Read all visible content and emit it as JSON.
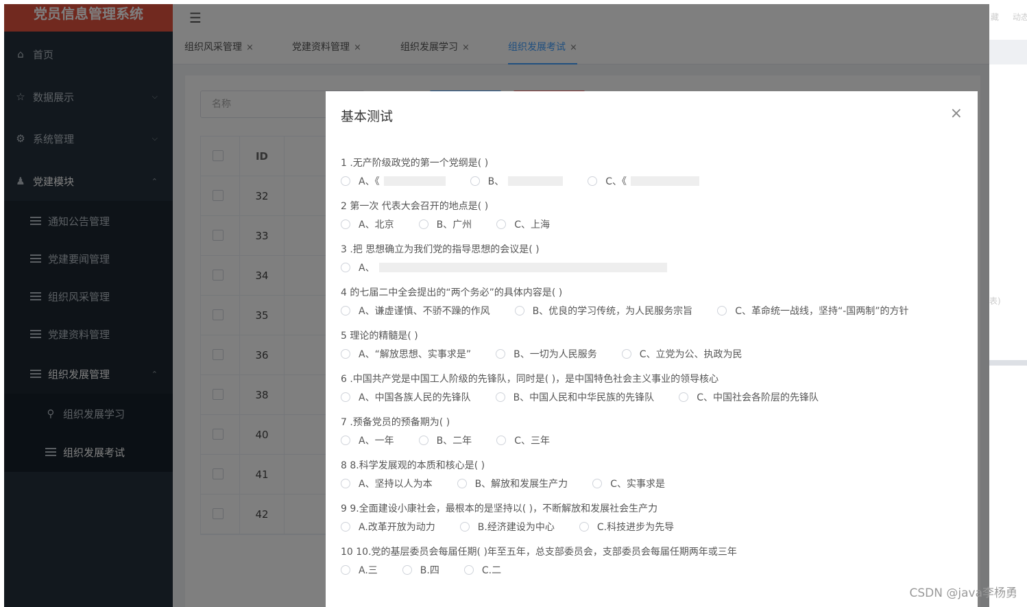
{
  "app": {
    "title": "党员信息管理系统"
  },
  "sidebar": {
    "items": [
      {
        "label": "首页",
        "icon": "home-icon"
      },
      {
        "label": "数据展示",
        "icon": "star-icon"
      },
      {
        "label": "系统管理",
        "icon": "gear-icon"
      },
      {
        "label": "党建模块",
        "icon": "user-icon"
      },
      {
        "label": "通知公告管理",
        "icon": "list-icon"
      },
      {
        "label": "党建要闻管理",
        "icon": "list-icon"
      },
      {
        "label": "组织风采管理",
        "icon": "list-icon"
      },
      {
        "label": "党建资料管理",
        "icon": "list-icon"
      },
      {
        "label": "组织发展管理",
        "icon": "list-icon"
      },
      {
        "label": "组织发展学习",
        "icon": "pin-icon"
      },
      {
        "label": "组织发展考试",
        "icon": "list-icon"
      }
    ]
  },
  "tabs": [
    {
      "label": "组织风采管理",
      "close": "×"
    },
    {
      "label": "党建资料管理",
      "close": "×"
    },
    {
      "label": "组织发展学习",
      "close": "×"
    },
    {
      "label": "组织发展考试",
      "close": "×"
    }
  ],
  "content": {
    "search_placeholder": "名称",
    "table": {
      "id_header": "ID",
      "ids": [
        "32",
        "33",
        "34",
        "35",
        "36",
        "38",
        "40",
        "41",
        "42"
      ]
    }
  },
  "modal": {
    "title": "基本测试",
    "close": "×",
    "questions": [
      {
        "text": "1 .无产阶级政党的第一个党纲是( )",
        "options": [
          "A、《",
          "B、",
          "C、《"
        ]
      },
      {
        "text": "2 第一次 代表大会召开的地点是( )",
        "options": [
          "A、北京",
          "B、广州",
          "C、上海"
        ]
      },
      {
        "text": "3 .把 思想确立为我们党的指导思想的会议是( )",
        "options": [
          "A、"
        ]
      },
      {
        "text": "4 的七届二中全会提出的“两个务必”的具体内容是( )",
        "options": [
          "A、谦虚谨慎、不骄不躁的作风",
          "B、优良的学习传统，为人民服务宗旨",
          "C、革命统一战线，坚持“-国两制”的方针"
        ]
      },
      {
        "text": "5 理论的精髓是( )",
        "options": [
          "A、“解放思想、实事求是”",
          "B、一切为人民服务",
          "C、立党为公、执政为民"
        ]
      },
      {
        "text": "6 .中国共产党是中国工人阶级的先锋队，同时是( )，是中国特色社会主义事业的领导核心",
        "options": [
          "A、中国各族人民的先锋队",
          "B、中国人民和中华民族的先锋队",
          "C、中国社会各阶层的先锋队"
        ]
      },
      {
        "text": "7 .预备党员的预备期为( )",
        "options": [
          "A、一年",
          "B、二年",
          "C、三年"
        ]
      },
      {
        "text": "8 8.科学发展观的本质和核心是( )",
        "options": [
          "A、坚持以人为本",
          "B、解放和发展生产力",
          "C、实事求是"
        ]
      },
      {
        "text": "9 9.全面建设小康社会，最根本的是坚持以( )，不断解放和发展社会生产力",
        "options": [
          "A.改革开放为动力",
          "B.经济建设为中心",
          "C.科技进步为先导"
        ]
      },
      {
        "text": "10 10.党的基层委员会每届任期( )年至五年，总支部委员会，支部委员会每届任期两年或三年",
        "options": [
          "A.三",
          "B.四",
          "C.二"
        ]
      }
    ]
  },
  "watermark": "CSDN @java李杨勇",
  "right_strip": [
    "藏",
    "动态",
    "表)"
  ]
}
